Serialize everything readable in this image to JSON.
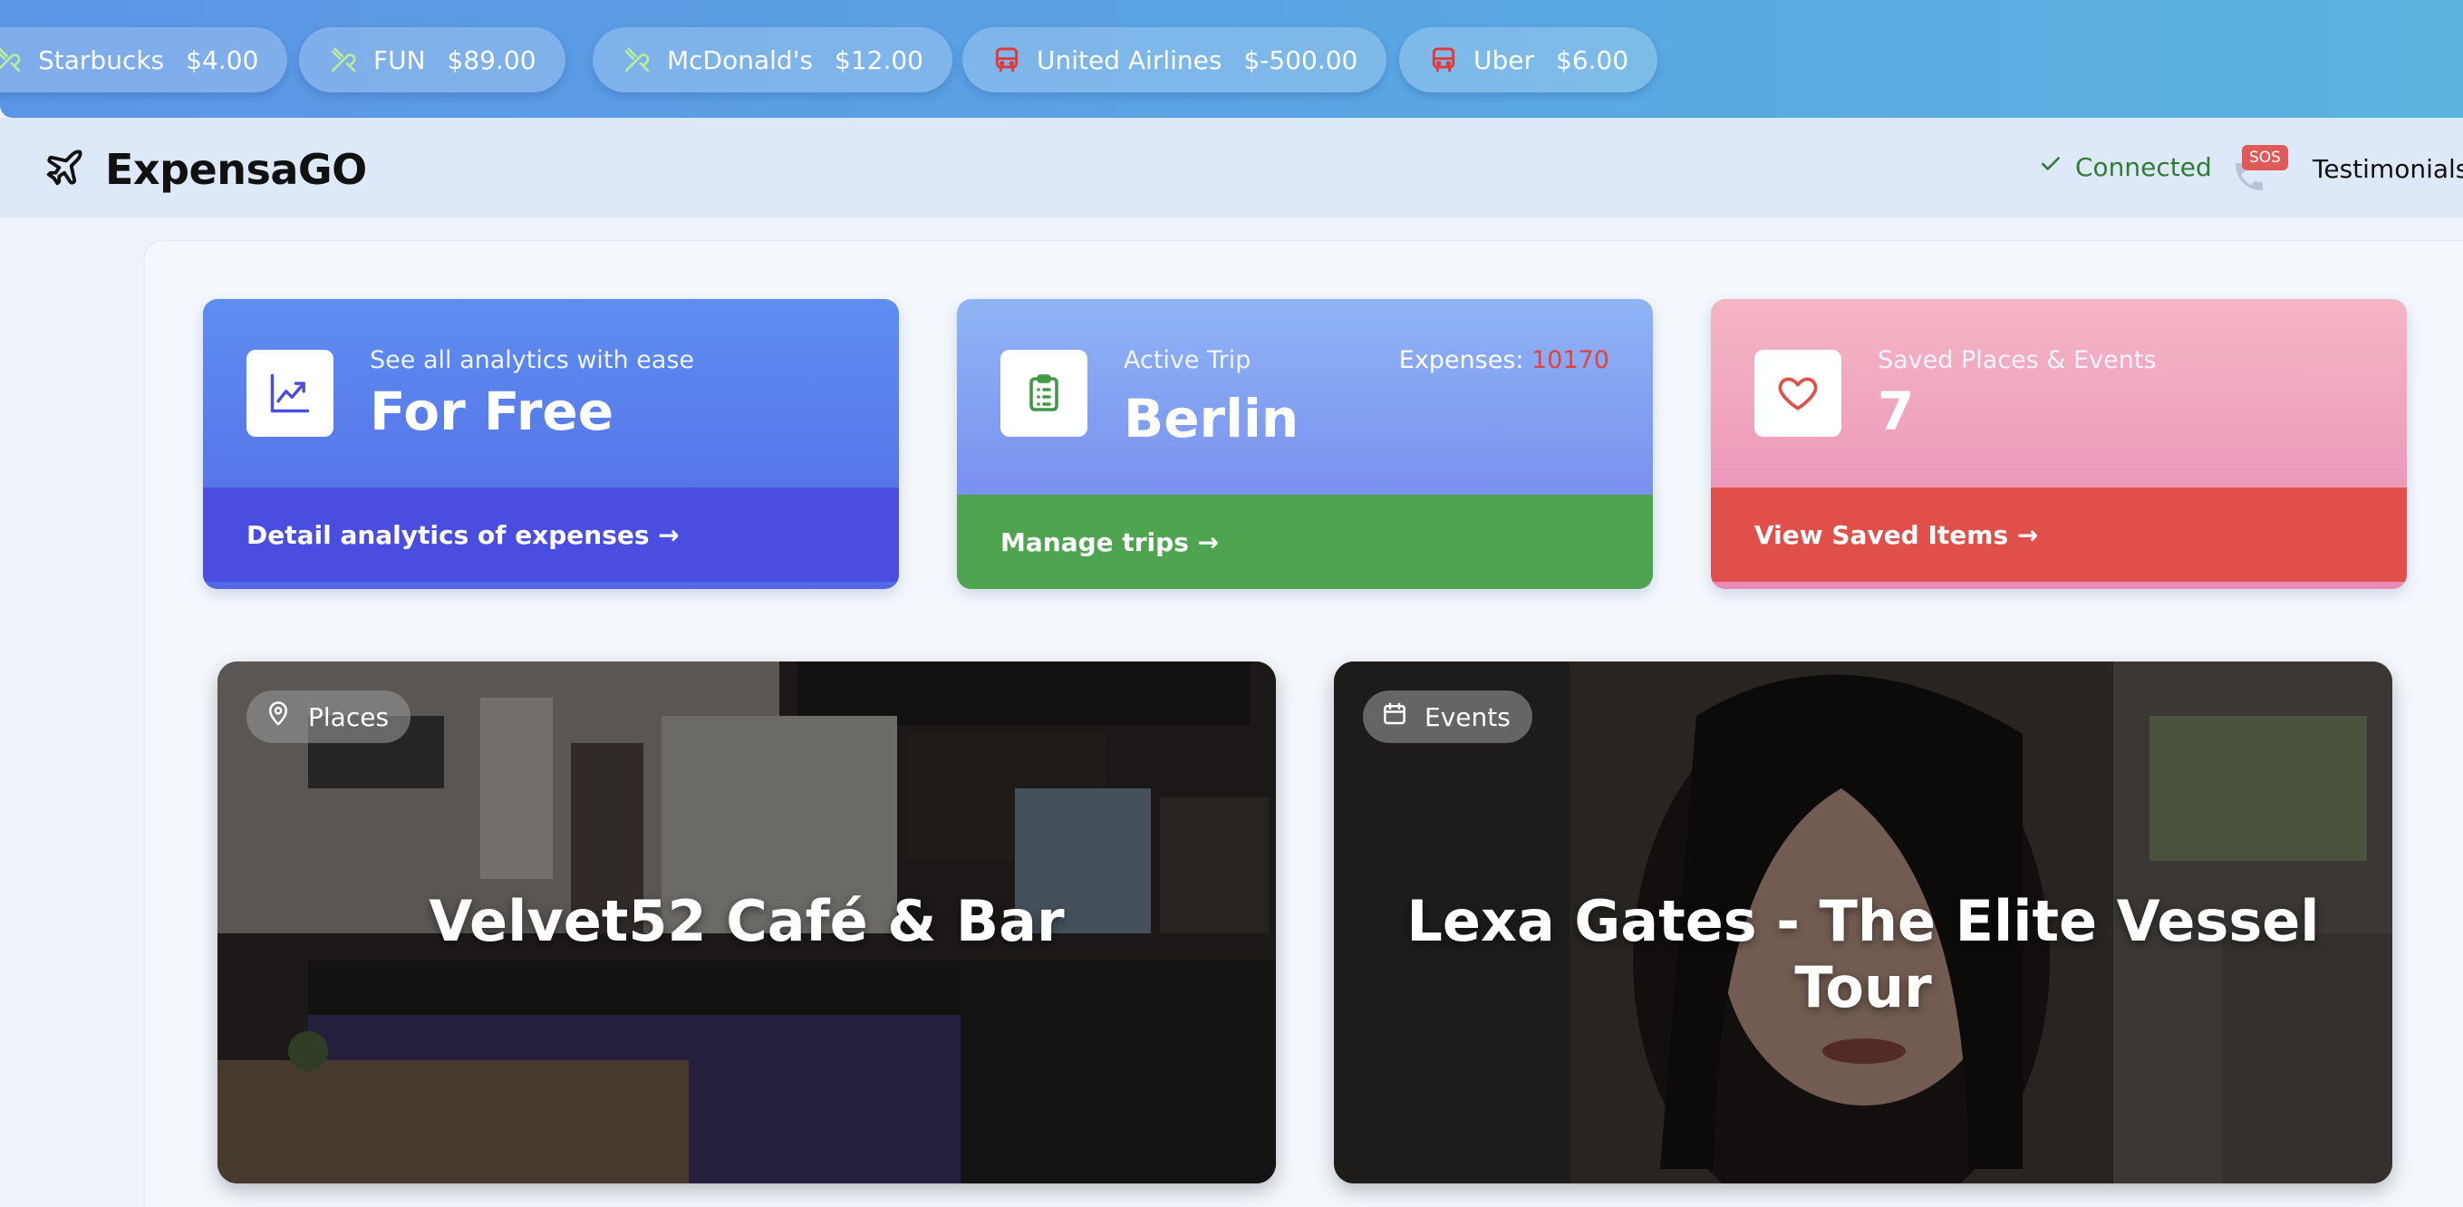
{
  "ticker": {
    "items": [
      {
        "name": "Starbucks",
        "amount": "$4.00",
        "icon": "utensils-icon",
        "icon_color": "#b9ec9a"
      },
      {
        "name": "FUN",
        "amount": "$89.00",
        "icon": "utensils-icon",
        "icon_color": "#b9ec9a"
      },
      {
        "name": "McDonald's",
        "amount": "$12.00",
        "icon": "utensils-icon",
        "icon_color": "#b9ec9a"
      },
      {
        "name": "United Airlines",
        "amount": "$-500.00",
        "icon": "bus-icon",
        "icon_color": "#e03a3a"
      },
      {
        "name": "Uber",
        "amount": "$6.00",
        "icon": "bus-icon",
        "icon_color": "#e03a3a"
      }
    ]
  },
  "header": {
    "brand": "ExpensaGO",
    "brand_icon": "plane-icon",
    "status": "Connected",
    "status_color": "#2f7d32",
    "sos_label": "SOS",
    "testimonials": "Testimonials"
  },
  "cards": {
    "analytics": {
      "kicker": "See all analytics with ease",
      "value": "For Free",
      "link": "Detail analytics of expenses →",
      "icon": "chart-line-icon"
    },
    "trip": {
      "kicker": "Active Trip",
      "value": "Berlin",
      "expenses_label": "Expenses: ",
      "expenses_value": "10170",
      "link": "Manage trips →",
      "icon": "clipboard-icon"
    },
    "saved": {
      "kicker": "Saved Places & Events",
      "value": "7",
      "link": "View Saved Items →",
      "icon": "heart-icon"
    }
  },
  "tiles": {
    "places": {
      "tag": "Places",
      "title": "Velvet52 Café & Bar",
      "icon": "map-pin-icon"
    },
    "events": {
      "tag": "Events",
      "title": "Lexa Gates - The Elite Vessel Tour",
      "icon": "calendar-icon"
    }
  },
  "colors": {
    "ticker_bg": "#5b95e6",
    "header_bg": "#dde8f8",
    "analytics_footer": "#4a4ee0",
    "trip_footer": "#4ea44f",
    "saved_footer": "#e04f49",
    "expenses_value": "#e0433a"
  }
}
